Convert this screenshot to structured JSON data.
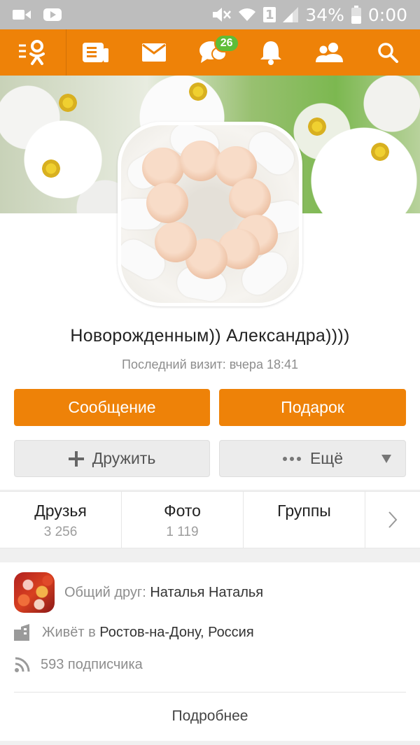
{
  "status_bar": {
    "battery": "34%",
    "time": "0:00",
    "sim": "1",
    "icons": [
      "video-notification-icon",
      "youtube-notification-icon",
      "mute-icon",
      "wifi-icon",
      "sim-icon",
      "signal-icon",
      "battery-icon"
    ]
  },
  "topnav": {
    "logo": "odnoklassniki-logo",
    "items": [
      "feed-icon",
      "mail-icon",
      "discussions-icon",
      "notifications-icon",
      "friends-icon",
      "search-icon"
    ],
    "discussions_badge": "26",
    "accent_color": "#ee8208",
    "badge_color": "#5ebd38"
  },
  "profile": {
    "name": "Новорожденным)) Александра))))",
    "last_visit": "Последний визит: вчера 18:41"
  },
  "actions": {
    "message": "Сообщение",
    "gift": "Подарок",
    "add_friend": "Дружить",
    "more": "Ещё"
  },
  "stats": [
    {
      "label": "Друзья",
      "value": "3 256"
    },
    {
      "label": "Фото",
      "value": "1 119"
    },
    {
      "label": "Группы",
      "value": ""
    }
  ],
  "info": {
    "mutual_prefix": "Общий друг:",
    "mutual_name": "Наталья Наталья",
    "lives_prefix": "Живёт в",
    "lives_city": "Ростов-на-Дону, Россия",
    "subscribers": "593 подписчика",
    "more_link": "Подробнее"
  }
}
